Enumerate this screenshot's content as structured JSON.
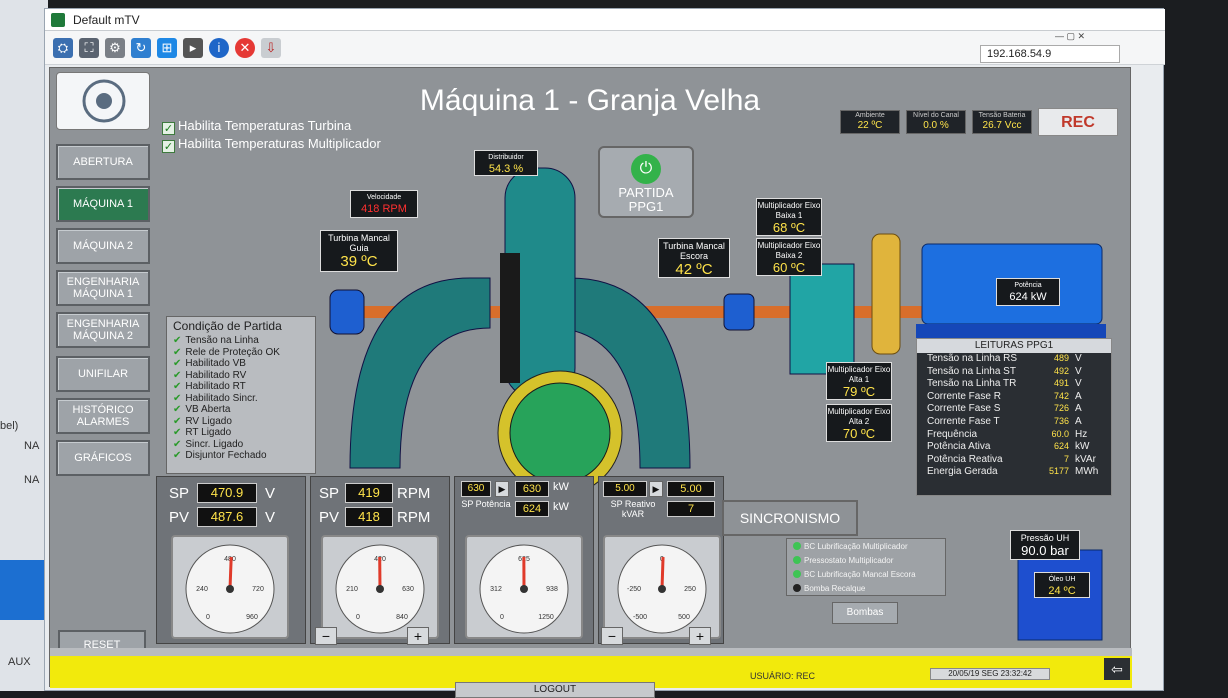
{
  "background": {
    "left_texts": [
      "bel)",
      "NA",
      "NA",
      "AUX"
    ]
  },
  "window": {
    "title": "Default mTV",
    "ip_address": "192.168.54.9"
  },
  "hmi": {
    "title": "Máquina 1 - Granja Velha",
    "header_boxes": [
      {
        "label": "Ambiente",
        "value": "22",
        "unit": "ºC"
      },
      {
        "label": "Nível do Canal",
        "value": "0.0",
        "unit": "%"
      },
      {
        "label": "Tensão Bateria",
        "value": "26.7",
        "unit": "Vcc"
      }
    ],
    "brand": "REC",
    "nav": [
      {
        "label": "ABERTURA",
        "active": false
      },
      {
        "label": "MÁQUINA 1",
        "active": true
      },
      {
        "label": "MÁQUINA 2",
        "active": false
      },
      {
        "label": "ENGENHARIA MÁQUINA 1",
        "active": false
      },
      {
        "label": "ENGENHARIA MÁQUINA 2",
        "active": false
      },
      {
        "label": "UNIFILAR",
        "active": false
      },
      {
        "label": "HISTÓRICO ALARMES",
        "active": false
      },
      {
        "label": "GRÁFICOS",
        "active": false
      }
    ],
    "reset_label": "RESET",
    "checks": [
      {
        "label": "Habilita Temperaturas Turbina",
        "checked": true
      },
      {
        "label": "Habilita Temperaturas Multiplicador",
        "checked": true
      }
    ],
    "displays": {
      "distribuidor": {
        "label": "Distribuidor",
        "value": "54.3",
        "unit": "%"
      },
      "velocidade": {
        "label": "Velocidade",
        "value": "418",
        "unit": "RPM"
      },
      "turbina_guia": {
        "label": "Turbina Mancal Guia",
        "value": "39",
        "unit": "ºC"
      },
      "turbina_escora": {
        "label": "Turbina Mancal Escora",
        "value": "42",
        "unit": "ºC"
      },
      "mult_baixa1": {
        "label": "Multiplicador Eixo Baixa 1",
        "value": "68",
        "unit": "ºC"
      },
      "mult_baixa2": {
        "label": "Multiplicador Eixo Baixa 2",
        "value": "60",
        "unit": "ºC"
      },
      "mult_alta1": {
        "label": "Multiplicador Eixo Alta 1",
        "value": "79",
        "unit": "ºC"
      },
      "mult_alta2": {
        "label": "Multiplicador Eixo Alta 2",
        "value": "70",
        "unit": "ºC"
      },
      "potencia": {
        "label": "Potência",
        "value": "624",
        "unit": "kW"
      },
      "pressao_uh": {
        "label": "Pressão UH",
        "value": "90.0",
        "unit": "bar"
      },
      "oleo_uh": {
        "label": "Óleo UH",
        "value": "24",
        "unit": "ºC"
      }
    },
    "partida": {
      "label": "PARTIDA PPG1"
    },
    "condicao": {
      "title": "Condição de Partida",
      "items": [
        "Tensão na Linha",
        "Rele de Proteção OK",
        "Habilitado VB",
        "Habilitado RV",
        "Habilitado RT",
        "Habilitado Sincr.",
        "VB Aberta",
        "RV Ligado",
        "RT Ligado",
        "Sincr. Ligado",
        "Disjuntor Fechado"
      ]
    },
    "leituras": {
      "title": "LEITURAS PPG1",
      "rows": [
        {
          "name": "Tensão na Linha RS",
          "value": "489",
          "unit": "V"
        },
        {
          "name": "Tensão na Linha ST",
          "value": "492",
          "unit": "V"
        },
        {
          "name": "Tensão na Linha TR",
          "value": "491",
          "unit": "V"
        },
        {
          "name": "Corrente Fase R",
          "value": "742",
          "unit": "A"
        },
        {
          "name": "Corrente Fase S",
          "value": "726",
          "unit": "A"
        },
        {
          "name": "Corrente Fase T",
          "value": "736",
          "unit": "A"
        },
        {
          "name": "Frequência",
          "value": "60.0",
          "unit": "Hz"
        },
        {
          "name": "Potência Ativa",
          "value": "624",
          "unit": "kW"
        },
        {
          "name": "Potência Reativa",
          "value": "7",
          "unit": "kVAr"
        },
        {
          "name": "Energia Gerada",
          "value": "5177",
          "unit": "MWh"
        }
      ]
    },
    "gauges": {
      "tensao": {
        "sp_label": "SP",
        "pv_label": "PV",
        "sp": "470.9",
        "pv": "487.6",
        "unit": "V",
        "ticks": [
          "480",
          "240",
          "720",
          "0",
          "960"
        ],
        "needle_fraction": 0.508
      },
      "rpm": {
        "sp_label": "SP",
        "pv_label": "PV",
        "sp": "419",
        "pv": "418",
        "unit": "RPM",
        "ticks": [
          "420",
          "210",
          "630",
          "0",
          "840"
        ],
        "needle_fraction": 0.498
      },
      "potencia": {
        "sp_label": "SP Potência",
        "set": "630",
        "sp": "630",
        "pv": "624",
        "unit": "kW",
        "ticks": [
          "625",
          "312",
          "938",
          "0",
          "1250"
        ],
        "needle_fraction": 0.499
      },
      "reativo": {
        "sp_label": "SP Reativo kVAR",
        "set": "5.00",
        "sp": "5.00",
        "pv": "7",
        "ticks": [
          "0",
          "-250",
          "250",
          "-500",
          "500"
        ],
        "needle_fraction": 0.507
      }
    },
    "sincronismo_label": "SINCRONISMO",
    "status_items": [
      {
        "label": "BC Lubrificação Multiplicador",
        "color": "#3ec454"
      },
      {
        "label": "Pressostato Multiplicador",
        "color": "#3ec454"
      },
      {
        "label": "BC Lubrificação Mancal Escora",
        "color": "#3ec454"
      },
      {
        "label": "Bomba Recalque",
        "color": "#222222"
      }
    ],
    "bombas_label": "Bombas",
    "usuario_label": "USUÁRIO:",
    "usuario": "REC",
    "datetime": "20/05/19  SEG  23:32:42",
    "logout_label": "LOGOUT",
    "minus_label": "−",
    "plus_label": "+"
  }
}
